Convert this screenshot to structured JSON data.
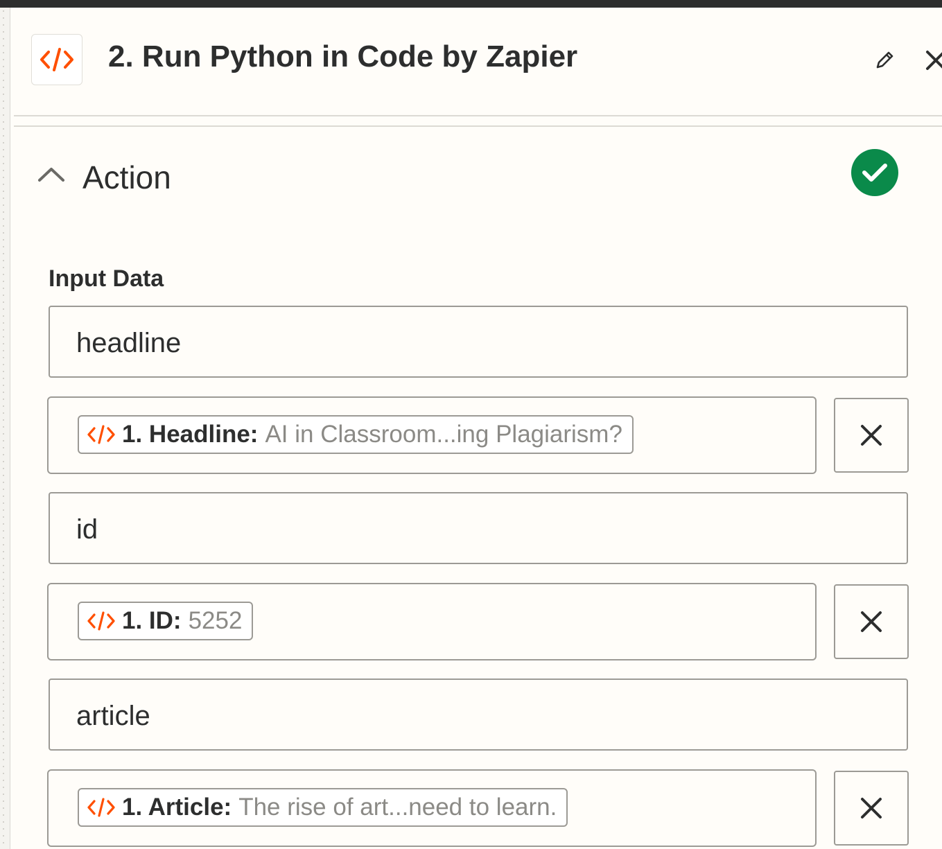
{
  "header": {
    "title": "2. Run Python in Code by Zapier",
    "app_icon": "code-icon",
    "edit_icon": "pencil-icon",
    "close_icon": "close-icon"
  },
  "section": {
    "title": "Action",
    "collapse_icon": "chevron-up-icon",
    "status_icon": "check-circle-icon",
    "status_color": "#0a8a4a"
  },
  "input_data": {
    "label": "Input Data",
    "rows": [
      {
        "key": "headline",
        "pill_label": "1. Headline:",
        "pill_value": "AI in Classroom...ing Plagiarism?"
      },
      {
        "key": "id",
        "pill_label": "1. ID:",
        "pill_value": "5252"
      },
      {
        "key": "article",
        "pill_label": "1. Article:",
        "pill_value": "The rise of art...need to learn."
      }
    ]
  },
  "colors": {
    "accent_orange": "#ff4f00",
    "text_dark": "#2d2e2e",
    "text_muted": "#8b8a86",
    "border": "#9c9a95"
  }
}
